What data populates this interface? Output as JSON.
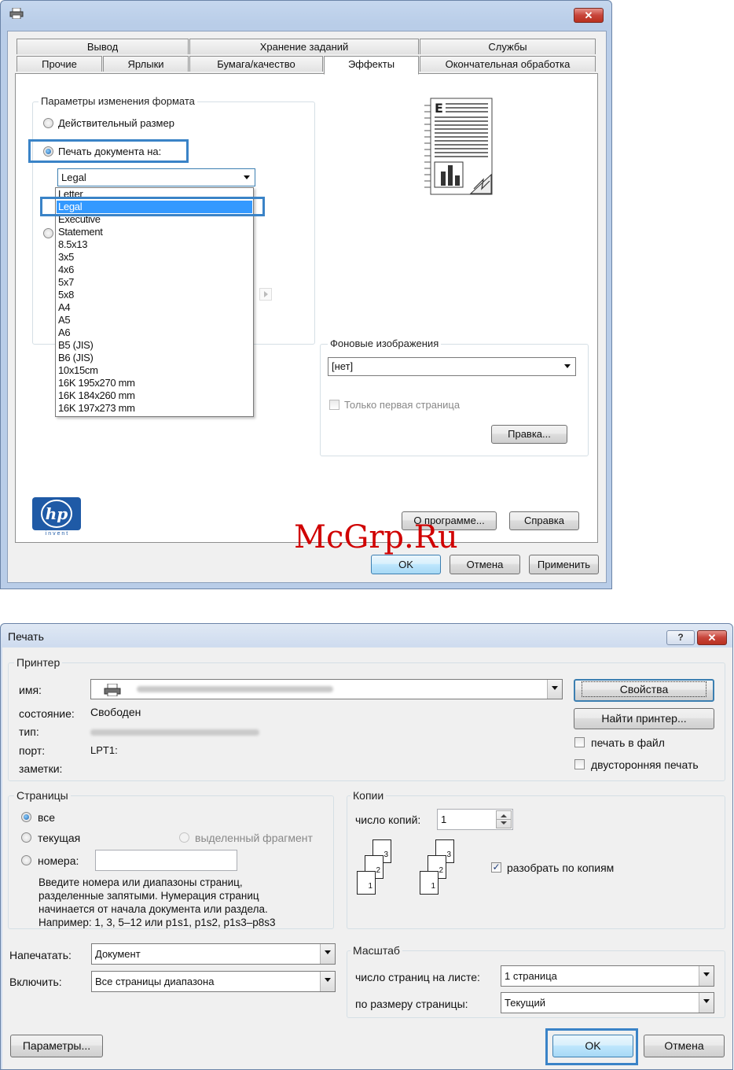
{
  "watermark": "McGrp.Ru",
  "dialog1": {
    "tabs_row1": [
      "Вывод",
      "Хранение заданий",
      "Службы"
    ],
    "tabs_row2": [
      "Прочие",
      "Ярлыки",
      "Бумага/качество",
      "Эффекты",
      "Окончательная обработка"
    ],
    "active_tab": "Эффекты",
    "resize_group": {
      "title": "Параметры изменения формата",
      "radio_actual": "Действительный размер",
      "radio_print_on": "Печать документа на:",
      "selected_paper": "Legal"
    },
    "paper_list": [
      "Letter",
      "Legal",
      "Executive",
      "Statement",
      "8.5x13",
      "3x5",
      "4x6",
      "5x7",
      "5x8",
      "A4",
      "A5",
      "A6",
      "B5 (JIS)",
      "B6 (JIS)",
      "10x15cm",
      "16K 195x270 mm",
      "16K 184x260 mm",
      "16K 197x273 mm"
    ],
    "background_group": {
      "title": "Фоновые изображения",
      "value": "[нет]",
      "first_page_only": "Только первая страница",
      "edit_button": "Правка..."
    },
    "about_button": "О программе...",
    "help_button": "Справка",
    "ok_button": "OK",
    "cancel_button": "Отмена",
    "apply_button": "Применить",
    "logo_text": "i n v e n t"
  },
  "dialog2": {
    "title": "Печать",
    "printer_group": {
      "title": "Принтер",
      "name_label": "имя:",
      "status_label": "состояние:",
      "status_value": "Свободен",
      "type_label": "тип:",
      "port_label": "порт:",
      "port_value": "LPT1:",
      "notes_label": "заметки:",
      "properties_button": "Свойства",
      "find_printer_button": "Найти принтер...",
      "print_to_file": "печать в файл",
      "duplex": "двусторонняя печать"
    },
    "pages_group": {
      "title": "Страницы",
      "all": "все",
      "current": "текущая",
      "selection": "выделенный фрагмент",
      "numbers": "номера:",
      "hint": [
        "Введите номера или диапазоны страниц,",
        "разделенные запятыми. Нумерация страниц",
        "начинается от начала документа или раздела.",
        "Например: 1, 3, 5–12 или p1s1, p1s2, p1s3–p8s3"
      ]
    },
    "copies_group": {
      "title": "Копии",
      "count_label": "число копий:",
      "count_value": "1",
      "collate": "разобрать по копиям",
      "page_numbers": [
        "3",
        "2",
        "1"
      ]
    },
    "print_what_label": "Напечатать:",
    "print_what_value": "Документ",
    "include_label": "Включить:",
    "include_value": "Все страницы диапазона",
    "zoom_group": {
      "title": "Масштаб",
      "pages_per_sheet_label": "число страниц на листе:",
      "pages_per_sheet_value": "1 страница",
      "scale_label": "по размеру страницы:",
      "scale_value": "Текущий"
    },
    "options_button": "Параметры...",
    "ok_button": "OK",
    "cancel_button": "Отмена"
  }
}
